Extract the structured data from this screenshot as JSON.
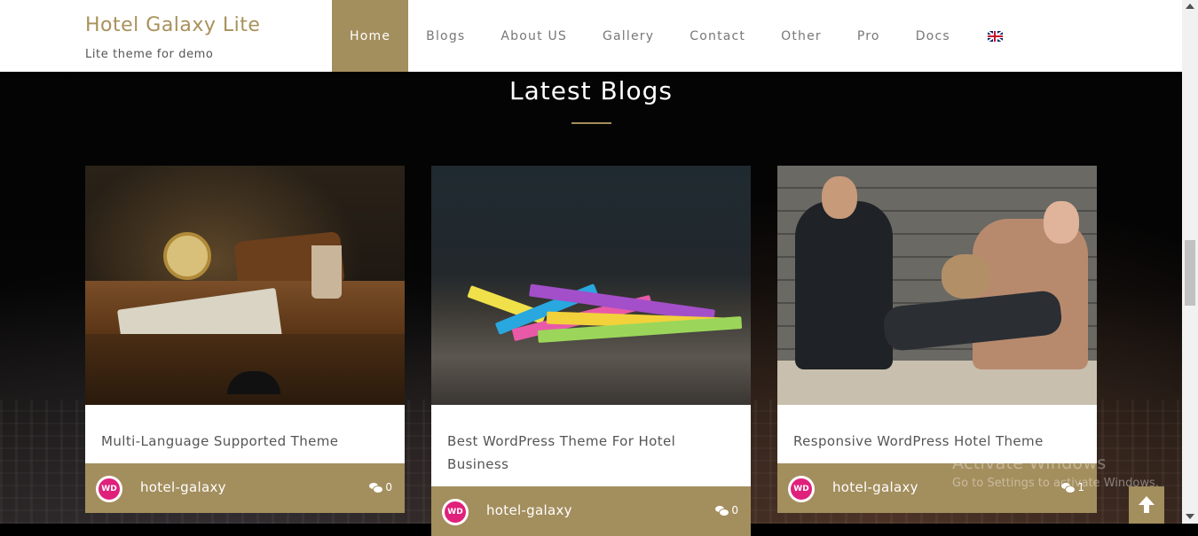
{
  "site": {
    "title": "Hotel Galaxy Lite",
    "tagline": "Lite theme for demo"
  },
  "nav": {
    "items": [
      {
        "label": "Home",
        "active": true
      },
      {
        "label": "Blogs"
      },
      {
        "label": "About US"
      },
      {
        "label": "Gallery"
      },
      {
        "label": "Contact"
      },
      {
        "label": "Other"
      },
      {
        "label": "Pro"
      },
      {
        "label": "Docs"
      }
    ],
    "language_icon": "uk-flag-icon"
  },
  "section": {
    "title": "Latest Blogs"
  },
  "posts": [
    {
      "title": "Multi-Language Supported Theme",
      "author": "hotel-galaxy",
      "comments": "0",
      "avatar_text": "WD"
    },
    {
      "title": "Best WordPress Theme For Hotel Business",
      "author": "hotel-galaxy",
      "comments": "0",
      "avatar_text": "WD"
    },
    {
      "title": "Responsive WordPress Hotel Theme",
      "author": "hotel-galaxy",
      "comments": "1",
      "avatar_text": "WD"
    }
  ],
  "watermark": {
    "line1": "Activate Windows",
    "line2": "Go to Settings to activate Windows."
  },
  "colors": {
    "accent": "#a38e5d",
    "brand": "#a8915b",
    "avatar": "#e0217b"
  },
  "icons": {
    "back_to_top": "arrow-up-icon",
    "comments": "comments-icon"
  }
}
